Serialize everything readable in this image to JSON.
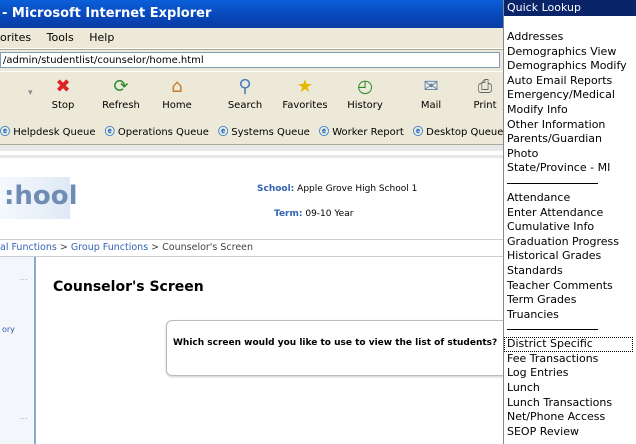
{
  "window": {
    "title": "- Microsoft Internet Explorer"
  },
  "menu": [
    "orites",
    "Tools",
    "Help"
  ],
  "address": {
    "url": "/admin/studentlist/counselor/home.html"
  },
  "toolbar": {
    "buttons": [
      {
        "label": "Stop",
        "icon": "stop-icon"
      },
      {
        "label": "Refresh",
        "icon": "refresh-icon"
      },
      {
        "label": "Home",
        "icon": "home-icon"
      },
      {
        "label": "Search",
        "icon": "search-icon"
      },
      {
        "label": "Favorites",
        "icon": "favorites-star-icon"
      },
      {
        "label": "History",
        "icon": "history-icon"
      },
      {
        "label": "Mail",
        "icon": "mail-icon"
      },
      {
        "label": "Print",
        "icon": "printer-icon"
      }
    ]
  },
  "links": [
    "Helpdesk Queue",
    "Operations Queue",
    "Systems Queue",
    "Worker Report",
    "Desktop Queue"
  ],
  "page": {
    "logo_text": ":hool",
    "school_label": "School:",
    "school_value": "Apple Grove High School 1",
    "term_label": "Term:",
    "term_value": "09-10 Year",
    "breadcrumb_link1": "al Functions",
    "breadcrumb_sep1": " > ",
    "breadcrumb_link2": "Group Functions",
    "breadcrumb_rest": " > Counselor's Screen",
    "side_text": "ory",
    "dots": "...",
    "title": "Counselor's Screen",
    "question": "Which screen would you like to use to view the list of students?"
  },
  "quick_lookup": {
    "header": "Quick Lookup",
    "group1": [
      "Addresses",
      "Demographics View",
      "Demographics Modify",
      "Auto Email Reports",
      "Emergency/Medical",
      "Modify Info",
      "Other Information",
      "Parents/Guardian",
      "Photo",
      "State/Province - MI"
    ],
    "group2": [
      "Attendance",
      "Enter Attendance",
      "Cumulative Info",
      "Graduation Progress",
      "Historical Grades",
      "Standards",
      "Teacher Comments",
      "Term Grades",
      "Truancies"
    ],
    "group3": [
      "District Specific",
      "Fee Transactions",
      "Log Entries",
      "Lunch",
      "Lunch Transactions",
      "Net/Phone Access",
      "SEOP Review"
    ]
  },
  "colors": {
    "titlebar": "#0846b9",
    "link_blue": "#3363b2",
    "selected_header": "#0a246a"
  }
}
